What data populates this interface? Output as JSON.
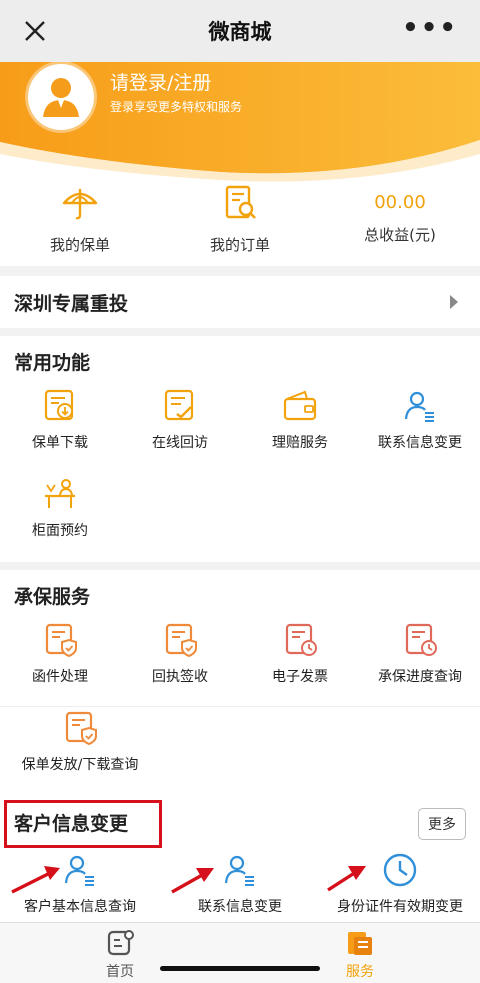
{
  "titlebar": {
    "title": "微商城",
    "close_icon": "close-icon",
    "more_icon": "more-dots-icon"
  },
  "hero": {
    "login_title": "请登录/注册",
    "login_subtitle": "登录享受更多特权和服务",
    "avatar_icon": "user-avatar-icon"
  },
  "stats": [
    {
      "label": "我的保单",
      "icon": "umbrella-icon"
    },
    {
      "label": "我的订单",
      "icon": "order-search-icon"
    },
    {
      "label": "总收益(元)",
      "value": "00.00"
    }
  ],
  "banner": {
    "label": "深圳专属重投"
  },
  "common": {
    "title": "常用功能",
    "items": [
      {
        "label": "保单下载",
        "icon": "download-doc-icon"
      },
      {
        "label": "在线回访",
        "icon": "edit-doc-icon"
      },
      {
        "label": "理赔服务",
        "icon": "wallet-icon"
      },
      {
        "label": "联系信息变更",
        "icon": "contact-icon"
      },
      {
        "label": "柜面预约",
        "icon": "counter-icon"
      }
    ]
  },
  "underwriting": {
    "title": "承保服务",
    "items": [
      {
        "label": "函件处理",
        "icon": "letter-shield-icon"
      },
      {
        "label": "回执签收",
        "icon": "receipt-shield-icon"
      },
      {
        "label": "电子发票",
        "icon": "invoice-clock-icon"
      },
      {
        "label": "承保进度查询",
        "icon": "progress-clock-icon"
      },
      {
        "label": "保单发放/下载查询",
        "icon": "policy-shield-icon"
      }
    ]
  },
  "customer": {
    "title": "客户信息变更",
    "more_label": "更多",
    "items": [
      {
        "label": "客户基本信息查询",
        "icon": "person-list-icon"
      },
      {
        "label": "联系信息变更",
        "icon": "person-list-icon"
      },
      {
        "label": "身份证件有效期变更",
        "icon": "clock-icon"
      }
    ]
  },
  "tabbar": [
    {
      "label": "首页",
      "icon": "home-icon",
      "active": false
    },
    {
      "label": "服务",
      "icon": "service-icon",
      "active": true
    }
  ],
  "colors": {
    "accent": "#f7a21b",
    "accent_text": "#f2a20c",
    "blue": "#2f8fd8",
    "red_icon": "#e06a5a",
    "red_box": "#d6101a"
  }
}
